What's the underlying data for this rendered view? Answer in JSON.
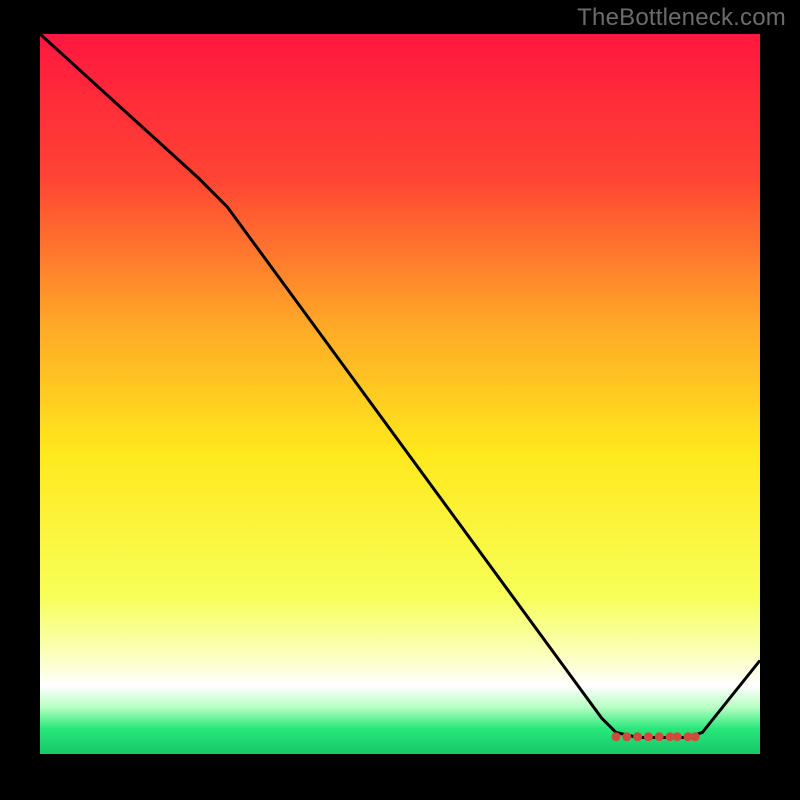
{
  "watermark": "TheBottleneck.com",
  "chart_data": {
    "type": "line",
    "title": "",
    "xlabel": "",
    "ylabel": "",
    "xlim": [
      0,
      100
    ],
    "ylim": [
      0,
      100
    ],
    "gradient_stops": [
      {
        "offset": 0.0,
        "color": "#ff173f"
      },
      {
        "offset": 0.2,
        "color": "#ff4433"
      },
      {
        "offset": 0.4,
        "color": "#ffa727"
      },
      {
        "offset": 0.58,
        "color": "#ffe81c"
      },
      {
        "offset": 0.78,
        "color": "#f7ff58"
      },
      {
        "offset": 0.86,
        "color": "#fbffb9"
      },
      {
        "offset": 0.905,
        "color": "#ffffff"
      },
      {
        "offset": 0.935,
        "color": "#b6ffc2"
      },
      {
        "offset": 0.965,
        "color": "#28e77a"
      },
      {
        "offset": 1.0,
        "color": "#16c768"
      }
    ],
    "series": [
      {
        "name": "bottleneck-curve",
        "color": "#000000",
        "points": [
          {
            "x": 0,
            "y": 100
          },
          {
            "x": 22,
            "y": 80
          },
          {
            "x": 26,
            "y": 76
          },
          {
            "x": 78,
            "y": 5
          },
          {
            "x": 80,
            "y": 3
          },
          {
            "x": 83,
            "y": 2.3
          },
          {
            "x": 90,
            "y": 2.3
          },
          {
            "x": 92,
            "y": 3
          },
          {
            "x": 100,
            "y": 13
          }
        ]
      }
    ],
    "markers": {
      "name": "optimal-range-dots",
      "color": "#d24a3a",
      "y": 2.4,
      "x_values": [
        80,
        81.5,
        83,
        84.5,
        86,
        87.5,
        88.5,
        90,
        91
      ]
    }
  }
}
